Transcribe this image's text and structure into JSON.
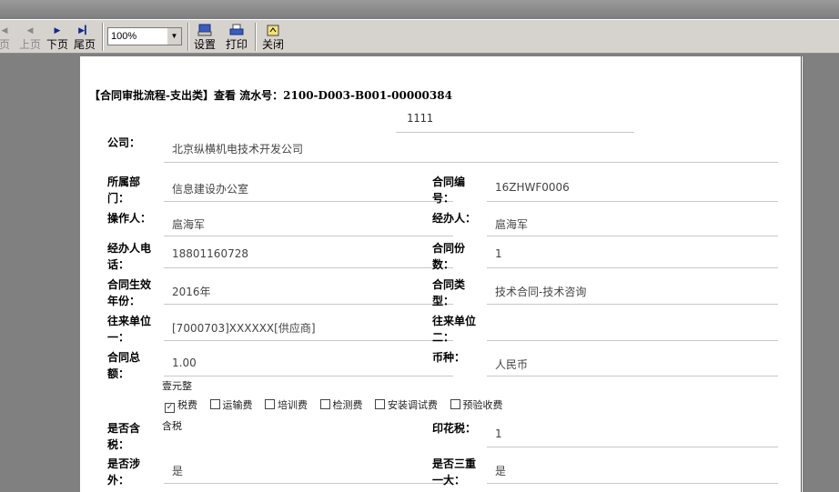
{
  "toolbar": {
    "first_label": "页",
    "prev_label": "上页",
    "next_label": "下页",
    "last_label": "尾页",
    "zoom_value": "100%",
    "settings_label": "设置",
    "print_label": "打印",
    "close_label": "关闭"
  },
  "form": {
    "heading": "【合同审批流程-支出类】查看  流水号：2100-D003-B001-00000384",
    "subtitle": "1111",
    "company_label": "公司：",
    "company_value": "北京纵横机电技术开发公司",
    "dept_label": "所属部门：",
    "dept_value": "信息建设办公室",
    "contract_no_label": "合同编号：",
    "contract_no_value": "16ZHWF0006",
    "operator_label": "操作人：",
    "operator_value": "扈海军",
    "handler_label": "经办人：",
    "handler_value": "扈海军",
    "handler_phone_label": "经办人电话：",
    "handler_phone_value": "18801160728",
    "copies_label": "合同份数：",
    "copies_value": "1",
    "effective_year_label": "合同生效年份：",
    "effective_year_value": "2016年",
    "contract_type_label": "合同类型：",
    "contract_type_value": "技术合同-技术咨询",
    "unit1_label": "往来单位一：",
    "unit1_value": "[7000703]XXXXXX[供应商]",
    "unit2_label": "往来单位二：",
    "unit2_value": "",
    "amount_label": "合同总额：",
    "amount_value": "1.00",
    "currency_label": "币种：",
    "currency_value": "人民币",
    "amount_words": "壹元整",
    "fees": [
      {
        "label": "税费",
        "checked": "✓"
      },
      {
        "label": "运输费",
        "checked": ""
      },
      {
        "label": "培训费",
        "checked": ""
      },
      {
        "label": "检测费",
        "checked": ""
      },
      {
        "label": "安装调试费",
        "checked": ""
      },
      {
        "label": "预验收费",
        "checked": ""
      }
    ],
    "tax_incl_label": "是否含税：",
    "tax_incl_value": "含税",
    "stamp_tax_label": "印花税：",
    "stamp_tax_value": "1",
    "foreign_label": "是否涉外：",
    "foreign_value": "是",
    "major_label": "是否三重一大：",
    "major_value": "是"
  }
}
